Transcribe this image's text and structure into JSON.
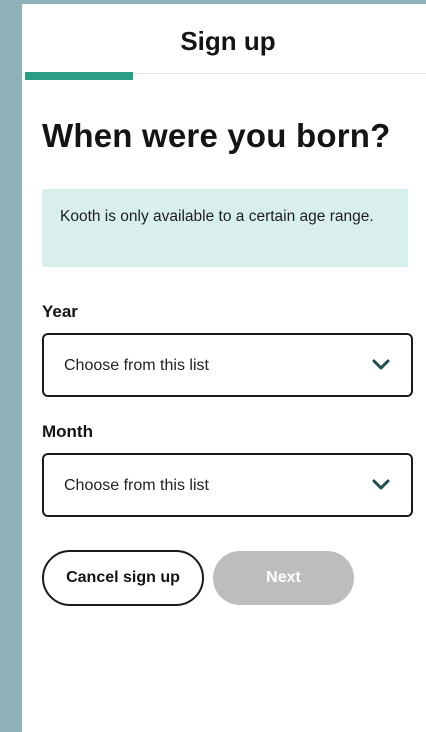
{
  "header": {
    "title": "Sign up"
  },
  "progress": {
    "fraction": 0.27,
    "color": "#2a9d85"
  },
  "question": {
    "title": "When were you born?"
  },
  "info": {
    "text": "Kooth is only available to a certain age range."
  },
  "year": {
    "label": "Year",
    "value": "Choose from this list",
    "icon": "chevron-down-icon"
  },
  "month": {
    "label": "Month",
    "value": "Choose from this list",
    "icon": "chevron-down-icon"
  },
  "buttons": {
    "cancel_label": "Cancel sign up",
    "next_label": "Next"
  },
  "colors": {
    "accent": "#2a9d85",
    "info_background": "#d9efed",
    "disabled_button": "#bdbdbd",
    "page_background": "#8fb2b8"
  }
}
